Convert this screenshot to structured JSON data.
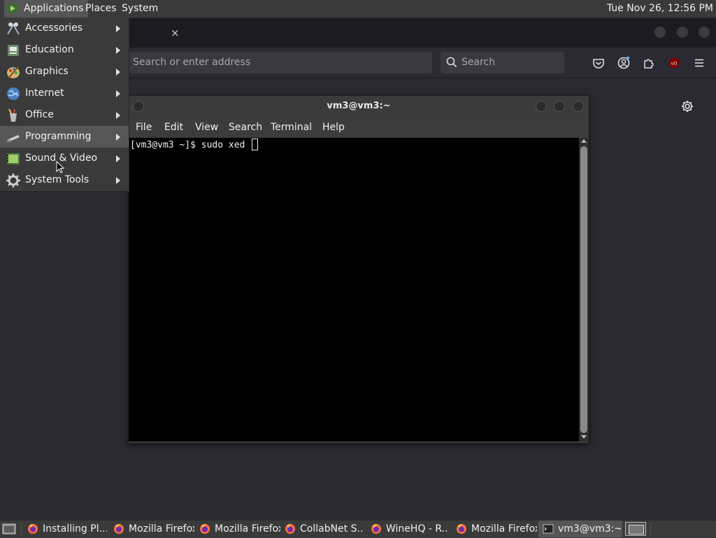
{
  "top_panel": {
    "applications": "Applications",
    "places": "Places",
    "system": "System",
    "clock": "Tue Nov 26, 12:56 PM"
  },
  "firefox": {
    "tab_close": "×",
    "url_placeholder": "Search or enter address",
    "search_placeholder": "Search",
    "toolbar_icons": [
      "pocket-icon",
      "account-icon",
      "extensions-icon",
      "ublock-icon",
      "hamburger-menu-icon"
    ]
  },
  "apps_menu": {
    "items": [
      {
        "label": "Accessories",
        "icon": "accessories-icon"
      },
      {
        "label": "Education",
        "icon": "education-icon"
      },
      {
        "label": "Graphics",
        "icon": "graphics-icon"
      },
      {
        "label": "Internet",
        "icon": "internet-icon"
      },
      {
        "label": "Office",
        "icon": "office-icon"
      },
      {
        "label": "Programming",
        "icon": "programming-icon"
      },
      {
        "label": "Sound & Video",
        "icon": "sound-video-icon"
      },
      {
        "label": "System Tools",
        "icon": "system-tools-icon"
      }
    ]
  },
  "terminal": {
    "title": "vm3@vm3:~",
    "menus": [
      "File",
      "Edit",
      "View",
      "Search",
      "Terminal",
      "Help"
    ],
    "command_line": "[vm3@vm3 ~]$ sudo xed "
  },
  "taskbar": {
    "items": [
      "Installing Pl...",
      "Mozilla Firefox",
      "Mozilla Firefox",
      "CollabNet S...",
      "WineHQ - R...",
      "Mozilla Firefox",
      "vm3@vm3:~"
    ]
  }
}
